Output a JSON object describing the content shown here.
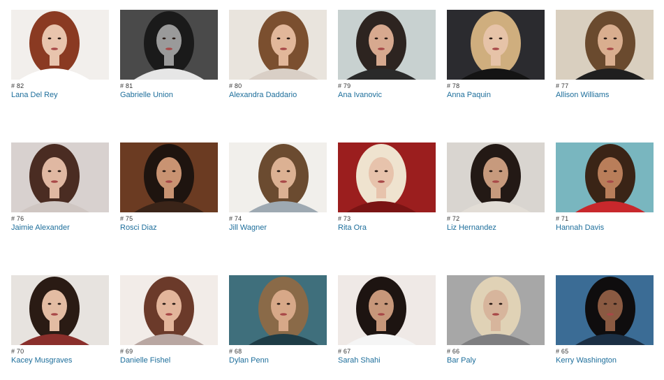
{
  "items": [
    {
      "rank": "# 82",
      "name": "Lana Del Rey",
      "bg": "#f2efec",
      "hair": "#8a3a22",
      "skin": "#e8c4ad",
      "top": "#ffffff"
    },
    {
      "rank": "# 81",
      "name": "Gabrielle Union",
      "bg": "#4a4a4a",
      "hair": "#1a1a1a",
      "skin": "#9a9a9a",
      "top": "#e6e6e6"
    },
    {
      "rank": "# 80",
      "name": "Alexandra Daddario",
      "bg": "#e9e4dd",
      "hair": "#7b4f2f",
      "skin": "#e2b79a",
      "top": "#d9cfc6"
    },
    {
      "rank": "# 79",
      "name": "Ana Ivanovic",
      "bg": "#c8d1d0",
      "hair": "#2d2420",
      "skin": "#d7a98f",
      "top": "#2a2a2a"
    },
    {
      "rank": "# 78",
      "name": "Anna Paquin",
      "bg": "#2b2b2f",
      "hair": "#cfae7e",
      "skin": "#e6c3a8",
      "top": "#141414"
    },
    {
      "rank": "# 77",
      "name": "Allison Williams",
      "bg": "#d9cfbf",
      "hair": "#6a4a2e",
      "skin": "#d9ae8f",
      "top": "#1f1f1f"
    },
    {
      "rank": "# 76",
      "name": "Jaimie Alexander",
      "bg": "#d8d1cf",
      "hair": "#4a2c22",
      "skin": "#e0b8a2",
      "top": "#cfc6c2"
    },
    {
      "rank": "# 75",
      "name": "Rosci Diaz",
      "bg": "#6b3b22",
      "hair": "#1e140f",
      "skin": "#c99372",
      "top": "#3a2418"
    },
    {
      "rank": "# 74",
      "name": "Jill Wagner",
      "bg": "#f1efeb",
      "hair": "#6b4b30",
      "skin": "#dcb193",
      "top": "#9ea9b2"
    },
    {
      "rank": "# 73",
      "name": "Rita Ora",
      "bg": "#9b1e1e",
      "hair": "#efe3cf",
      "skin": "#e7c3ac",
      "top": "#7a1414"
    },
    {
      "rank": "# 72",
      "name": "Liz Hernandez",
      "bg": "#d9d5d0",
      "hair": "#231915",
      "skin": "#c79a7d",
      "top": "#e2ddd6"
    },
    {
      "rank": "# 71",
      "name": "Hannah Davis",
      "bg": "#79b6bf",
      "hair": "#3a2416",
      "skin": "#b97e5a",
      "top": "#c8282c"
    },
    {
      "rank": "# 70",
      "name": "Kacey Musgraves",
      "bg": "#e7e3df",
      "hair": "#2a1b14",
      "skin": "#e3bca3",
      "top": "#8a2f2b"
    },
    {
      "rank": "# 69",
      "name": "Danielle Fishel",
      "bg": "#f2ece8",
      "hair": "#6b3a2a",
      "skin": "#e3b59b",
      "top": "#b9a7a2"
    },
    {
      "rank": "# 68",
      "name": "Dylan Penn",
      "bg": "#3f6f7c",
      "hair": "#8a6a48",
      "skin": "#d7a888",
      "top": "#1e3c46"
    },
    {
      "rank": "# 67",
      "name": "Sarah Shahi",
      "bg": "#efe9e6",
      "hair": "#1d1411",
      "skin": "#c7977a",
      "top": "#f5f5f5"
    },
    {
      "rank": "# 66",
      "name": "Bar Paly",
      "bg": "#a7a7a7",
      "hair": "#e0d2b6",
      "skin": "#d7b59c",
      "top": "#7e7e80"
    },
    {
      "rank": "# 65",
      "name": "Kerry Washington",
      "bg": "#3b6c95",
      "hair": "#0f0d0e",
      "skin": "#8a5a42",
      "top": "#1b2f44"
    }
  ]
}
